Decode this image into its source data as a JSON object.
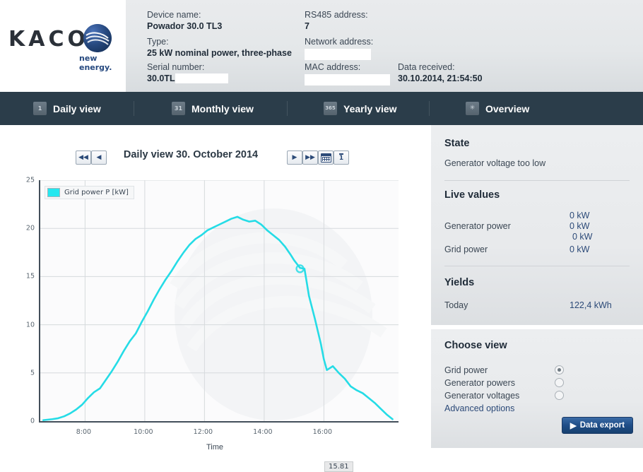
{
  "brand": {
    "name": "KACO",
    "tagline": "new energy.",
    "logo_icon": "globe-waves-logo",
    "color": "#26497f"
  },
  "header": {
    "fields": [
      {
        "label": "Device name:",
        "value": "Powador 30.0 TL3",
        "redacted": false
      },
      {
        "label": "Type:",
        "value": "25 kW nominal power, three-phase",
        "redacted": false
      },
      {
        "label": "Serial number:",
        "value": "30.0TL",
        "redacted": true
      },
      {
        "label": "RS485 address:",
        "value": "7",
        "redacted": false
      },
      {
        "label": "Network address:",
        "value": "",
        "redacted": true
      },
      {
        "label": "MAC address:",
        "value": "",
        "redacted": true
      },
      {
        "label": "Data received:",
        "value": "30.10.2014, 21:54:50",
        "redacted": false
      }
    ]
  },
  "nav": {
    "tabs": [
      {
        "label": "Daily view",
        "icon": "1",
        "icon_name": "calendar-day-icon",
        "active": true
      },
      {
        "label": "Monthly view",
        "icon": "31",
        "icon_name": "calendar-month-icon",
        "active": false
      },
      {
        "label": "Yearly view",
        "icon": "365",
        "icon_name": "calendar-year-icon",
        "active": false
      },
      {
        "label": "Overview",
        "icon": "✳",
        "icon_name": "overview-asterisk-icon",
        "active": false
      }
    ]
  },
  "chart_nav": {
    "title": "Daily view 30. October 2014",
    "prev_fast": "◀◀",
    "prev": "◀",
    "next": "▶",
    "next_fast": "▶▶",
    "calendar_icon": "calendar-icon",
    "today_label": "1"
  },
  "chart_data": {
    "type": "line",
    "title": "Daily view 30. October 2014",
    "xlabel": "Time",
    "ylabel": "",
    "legend": [
      "Grid power P [kW]"
    ],
    "legend_position": "top-left-inside",
    "series_color": "#25dce6",
    "grid": true,
    "xlim": [
      6.5,
      18.5
    ],
    "ylim": [
      0,
      25
    ],
    "yticks": [
      0,
      5,
      10,
      15,
      20,
      25
    ],
    "xticks": [
      8,
      10,
      12,
      14,
      16
    ],
    "xticklabels": [
      "8:00",
      "10:00",
      "12:00",
      "14:00",
      "16:00"
    ],
    "annotation": {
      "label": "15.81",
      "x": 15.2,
      "y": 15.81
    },
    "series": [
      {
        "name": "Grid power P [kW]",
        "x": [
          6.6,
          6.9,
          7.1,
          7.3,
          7.5,
          7.7,
          7.9,
          8.1,
          8.3,
          8.5,
          8.7,
          8.9,
          9.1,
          9.3,
          9.5,
          9.7,
          9.9,
          10.1,
          10.3,
          10.5,
          10.7,
          10.9,
          11.1,
          11.3,
          11.5,
          11.7,
          11.9,
          12.1,
          12.3,
          12.5,
          12.7,
          12.9,
          13.1,
          13.3,
          13.5,
          13.7,
          13.9,
          14.1,
          14.3,
          14.5,
          14.7,
          14.9,
          15.0,
          15.2,
          15.35,
          15.5,
          15.7,
          15.9,
          16.0,
          16.1,
          16.3,
          16.5,
          16.7,
          16.9,
          17.1,
          17.3,
          17.5,
          17.7,
          17.9,
          18.1,
          18.3
        ],
        "y": [
          0.1,
          0.2,
          0.3,
          0.5,
          0.8,
          1.2,
          1.7,
          2.4,
          3.0,
          3.4,
          4.3,
          5.2,
          6.2,
          7.3,
          8.3,
          9.1,
          10.3,
          11.4,
          12.6,
          13.7,
          14.7,
          15.6,
          16.6,
          17.5,
          18.3,
          18.9,
          19.3,
          19.8,
          20.1,
          20.4,
          20.7,
          21.0,
          21.2,
          20.9,
          20.7,
          20.8,
          20.4,
          19.8,
          19.3,
          18.8,
          18.1,
          17.2,
          16.7,
          15.9,
          15.81,
          13.0,
          10.6,
          8.0,
          6.4,
          5.3,
          5.7,
          5.0,
          4.4,
          3.6,
          3.2,
          2.9,
          2.4,
          1.9,
          1.3,
          0.7,
          0.2
        ]
      }
    ]
  },
  "sidebar": {
    "state": {
      "title": "State",
      "text": "Generator voltage too low"
    },
    "live_values": {
      "title": "Live values",
      "rows": [
        {
          "label": "Generator power",
          "values": [
            "0 kW",
            "0 kW",
            "0 kW"
          ]
        },
        {
          "label": "Grid power",
          "values": [
            "0 kW"
          ]
        }
      ]
    },
    "yields": {
      "title": "Yields",
      "rows": [
        {
          "label": "Today",
          "value": "122,4 kWh"
        }
      ]
    },
    "choose_view": {
      "title": "Choose view",
      "options": [
        {
          "label": "Grid power",
          "selected": true
        },
        {
          "label": "Generator powers",
          "selected": false
        },
        {
          "label": "Generator voltages",
          "selected": false
        }
      ],
      "advanced_link": "Advanced options",
      "export_button": "Data export",
      "export_arrow": "▶"
    }
  }
}
